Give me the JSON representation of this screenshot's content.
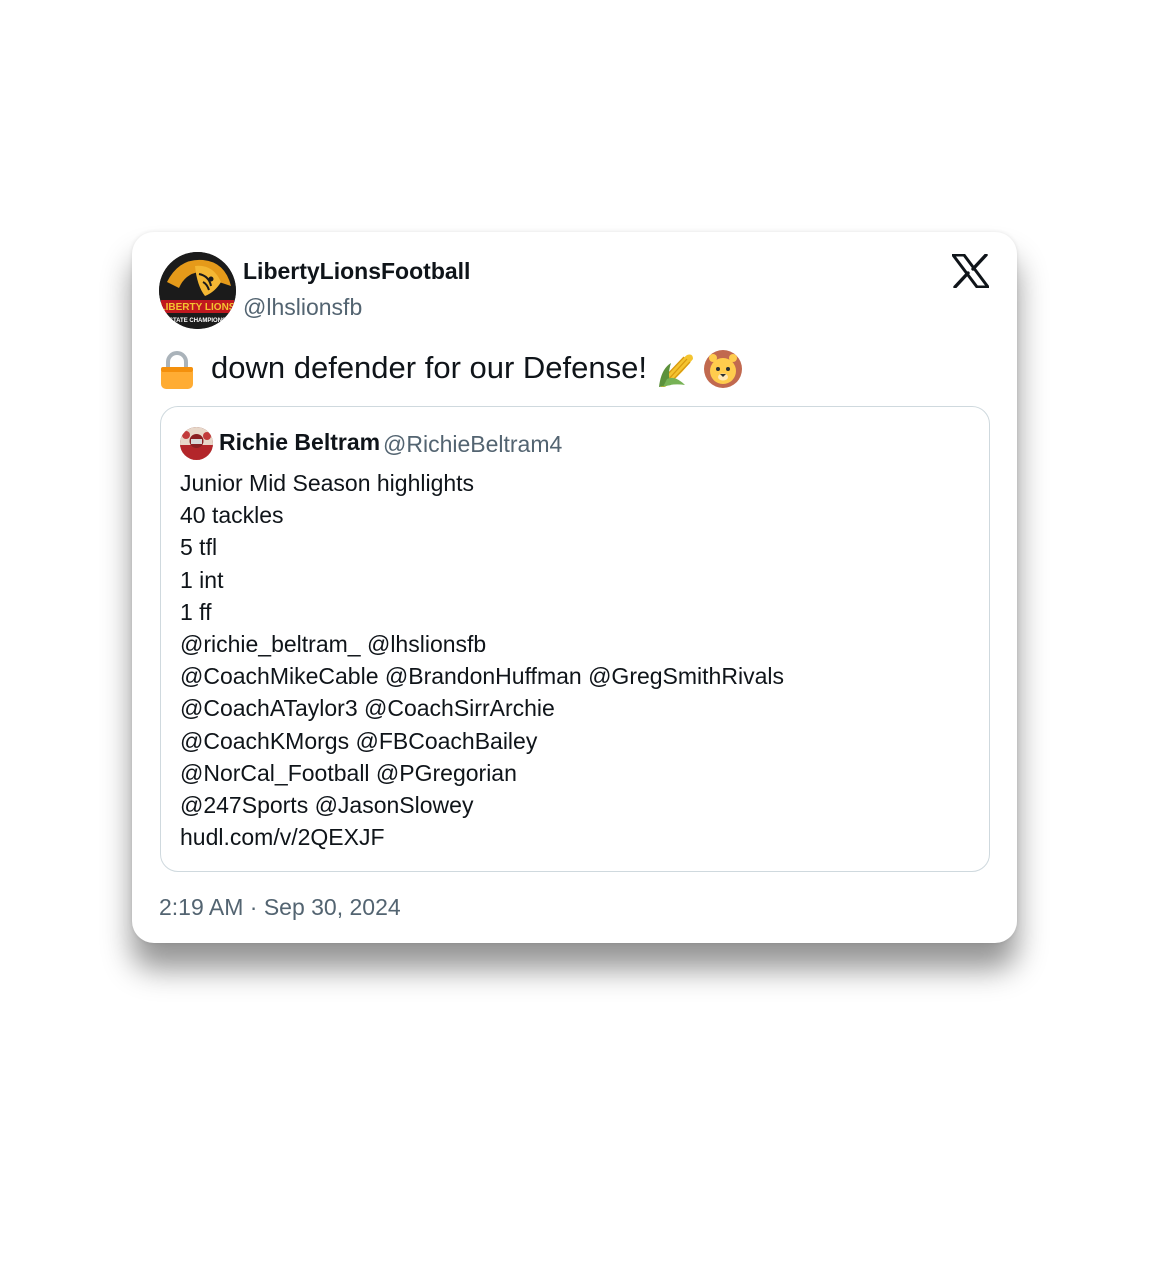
{
  "tweet": {
    "author": {
      "display_name": "LibertyLionsFootball",
      "handle": "@lhslionsfb",
      "avatar_icon": "liberty-lions-logo",
      "avatar_text": "LIBERTY LIONS",
      "avatar_subtext": "STATE CHAMPIONS"
    },
    "platform_icon": "x-logo-icon",
    "text": "down defender for our Defense!",
    "leading_emoji": "lock-icon",
    "trailing_emojis": [
      "corn-icon",
      "lion-face-icon"
    ],
    "timestamp": "2:19 AM · Sep 30, 2024"
  },
  "quoted_tweet": {
    "display_name": "Richie Beltram",
    "handle": "@RichieBeltram4",
    "avatar_icon": "user-avatar",
    "lines": [
      "Junior Mid Season highlights",
      "40 tackles",
      "5 tfl",
      "1 int",
      "1 ff",
      "@richie_beltram_  @lhslionsfb",
      "@CoachMikeCable @BrandonHuffman @GregSmithRivals",
      "@CoachATaylor3 @CoachSirrArchie",
      "@CoachKMorgs @FBCoachBailey",
      "@NorCal_Football @PGregorian",
      "@247Sports @JasonSlowey",
      "hudl.com/v/2QEXJF"
    ]
  },
  "colors": {
    "text": "#0f1419",
    "secondary_text": "#536471",
    "border": "#cfd9de",
    "accent_gold": "#f2a516"
  }
}
